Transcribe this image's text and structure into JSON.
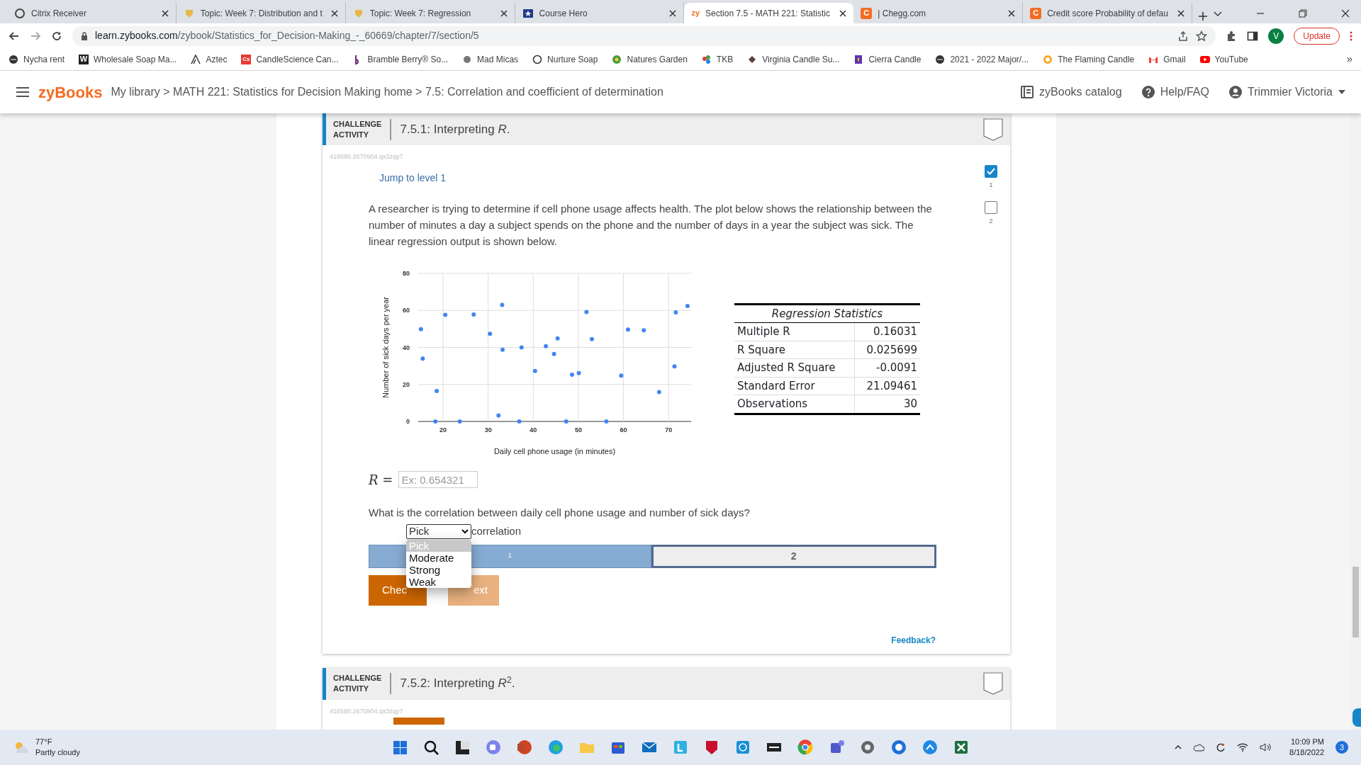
{
  "browser": {
    "tabs": [
      {
        "title": "Citrix Receiver",
        "selected": false
      },
      {
        "title": "Topic: Week 7: Distribution and t",
        "selected": false
      },
      {
        "title": "Topic: Week 7: Regression",
        "selected": false
      },
      {
        "title": "Course Hero",
        "selected": false
      },
      {
        "title": "Section 7.5 - MATH 221: Statistic",
        "icon_text": "zy",
        "selected": true
      },
      {
        "title": "| Chegg.com",
        "icon_text": "C",
        "selected": false
      },
      {
        "title": "Credit score Probability of defau",
        "icon_text": "C",
        "selected": false
      }
    ],
    "url": {
      "domain": "learn.zybooks.com",
      "path": "/zybook/Statistics_for_Decision-Making_-_60669/chapter/7/section/5"
    },
    "profile_initial": "V",
    "update_button": "Update",
    "bookmarks": [
      {
        "label": "Nycha rent"
      },
      {
        "label": "Wholesale Soap Ma...",
        "icon_text": "W"
      },
      {
        "label": "Aztec"
      },
      {
        "label": "CandleScience Can...",
        "icon_text": "Cs"
      },
      {
        "label": "Bramble Berry® So..."
      },
      {
        "label": "Mad Micas"
      },
      {
        "label": "Nurture Soap"
      },
      {
        "label": "Natures Garden"
      },
      {
        "label": "TKB"
      },
      {
        "label": "Virginia Candle Su..."
      },
      {
        "label": "Cierra Candle"
      },
      {
        "label": "2021 - 2022 Major/..."
      },
      {
        "label": "The Flaming Candle"
      },
      {
        "label": "Gmail"
      },
      {
        "label": "YouTube"
      }
    ],
    "more_bookmarks": "»"
  },
  "header": {
    "logo": "zyBooks",
    "breadcrumb": "My library > MATH 221: Statistics for Decision Making home > 7.5: Correlation and coefficient of determination",
    "catalog": "zyBooks catalog",
    "help": "Help/FAQ",
    "user": "Trimmier Victoria"
  },
  "activity": {
    "badge": [
      "CHALLENGE",
      "ACTIVITY"
    ],
    "title": "7.5.1: Interpreting *R*.",
    "code": "416580.2670904.qx3zqy7",
    "jump_link": "Jump to level 1",
    "levels": [
      {
        "label": "1",
        "checked": true
      },
      {
        "label": "2",
        "checked": false
      }
    ],
    "prompt": "A researcher is trying to determine if cell phone usage affects health. The plot below shows the relationship between the number of minutes a day a subject spends on the phone and the number of days in a year the subject was sick. The linear regression output is shown below.",
    "chart_data": {
      "type": "scatter",
      "grid": true,
      "xlabel": "Daily cell phone usage (in minutes)",
      "ylabel": "Number of sick days per year",
      "xlim": [
        14.5,
        75
      ],
      "ylim": [
        0,
        80
      ],
      "xticks": [
        20,
        30,
        40,
        50,
        60,
        70
      ],
      "yticks": [
        0,
        20,
        40,
        60,
        80
      ],
      "x": [
        15.1,
        15.5,
        18.6,
        18.3,
        20.5,
        23.7,
        26.8,
        30.4,
        32.3,
        33.1,
        33.2,
        36.9,
        37.4,
        40.4,
        42.8,
        44.6,
        45.4,
        47.3,
        48.6,
        50.1,
        51.8,
        53,
        56.2,
        59.5,
        61,
        64.5,
        67.9,
        71.3,
        71.6,
        74.2
      ],
      "series": [
        {
          "color": "#4285f4",
          "values": [
            49.9,
            34,
            16.5,
            0,
            57.6,
            0,
            57.8,
            47.4,
            3.3,
            63,
            38.8,
            0,
            40,
            27.3,
            40.7,
            36.5,
            44.9,
            0,
            25.3,
            26.1,
            59.1,
            44.5,
            0,
            24.8,
            49.7,
            49.3,
            15.9,
            29.8,
            58.9,
            62.4
          ]
        }
      ]
    },
    "regression_table": {
      "title": "Regression Statistics",
      "rows": [
        [
          "Multiple R",
          "0.16031"
        ],
        [
          "R Square",
          "0.025699"
        ],
        [
          "Adjusted R Square",
          "-0.0091"
        ],
        [
          "Standard Error",
          "21.09461"
        ],
        [
          "Observations",
          "30"
        ]
      ]
    },
    "answer": {
      "label": "*R* =",
      "placeholder": "Ex: 0.654321"
    },
    "question": "What is the correlation between daily cell phone usage and number of sick days?",
    "select": {
      "value": "Pick",
      "suffix": "correlation",
      "expanded": true,
      "options": [
        {
          "label": "Pick",
          "selected": true
        },
        {
          "label": "Moderate",
          "selected": false
        },
        {
          "label": "Strong",
          "selected": false
        },
        {
          "label": "Weak",
          "selected": false
        }
      ]
    },
    "progress": [
      {
        "label": "1",
        "completed": true,
        "selected": false
      },
      {
        "label": "2",
        "completed": false,
        "selected": true
      }
    ],
    "buttons": [
      {
        "label": "Chec",
        "kind": "primary"
      },
      {
        "label": "ext",
        "kind": "disabled"
      }
    ],
    "feedback": "Feedback?"
  },
  "next_activity": {
    "badge": [
      "CHALLENGE",
      "ACTIVITY"
    ],
    "title": "7.5.2: Interpreting *R*$^{2}$.",
    "code": "416580.2670904.qx3zqy7"
  },
  "taskbar": {
    "temperature": "77°F",
    "weather": "Partly cloudy",
    "time": "10:09 PM",
    "date": "8/18/2022",
    "notifications": "3"
  }
}
